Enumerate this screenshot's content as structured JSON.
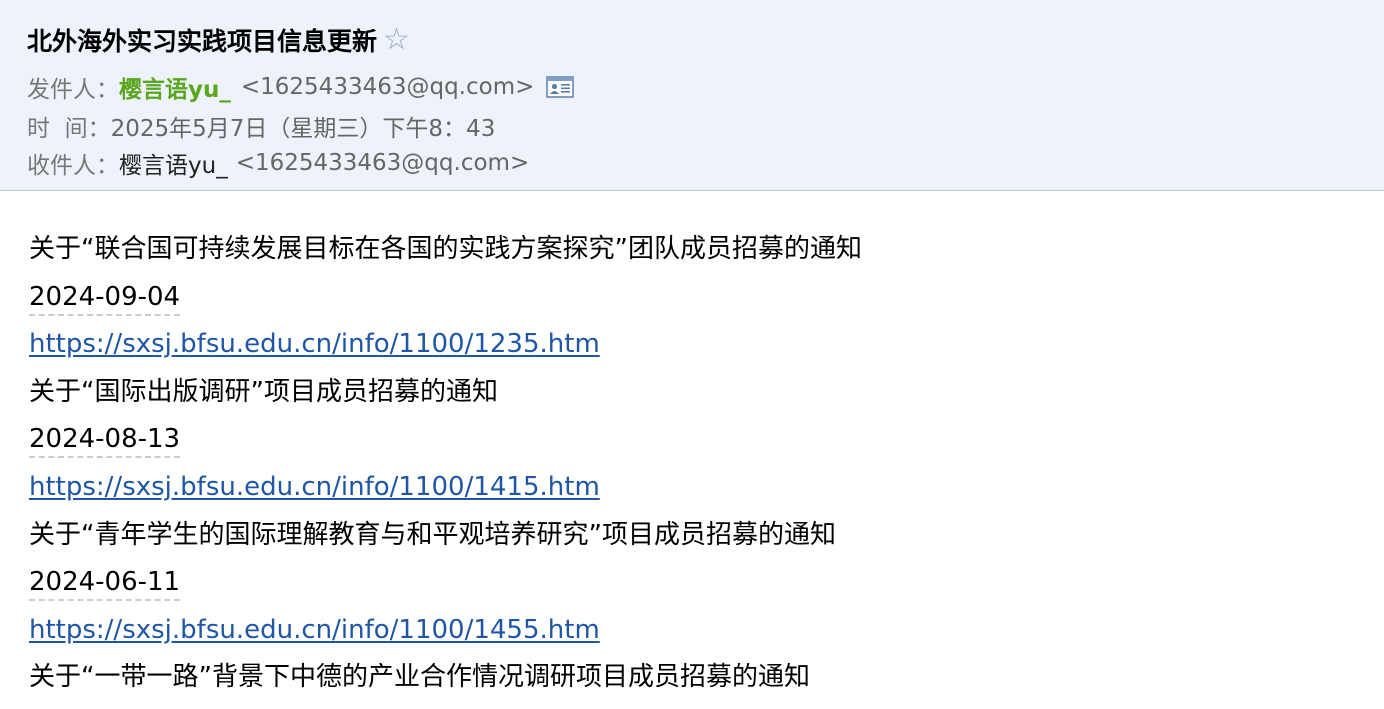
{
  "header": {
    "subject": "北外海外实习实践项目信息更新",
    "star_glyph": "☆",
    "from_label": "发件人：",
    "sender_name": "樱言语yu_",
    "sender_email": "<1625433463@qq.com>",
    "time_label": "时  间：",
    "time_value": "2025年5月7日（星期三）下午8：43",
    "to_label": "收件人：",
    "recipient_name": "樱言语yu_",
    "recipient_email": "<1625433463@qq.com>",
    "icons": {
      "star": "star-outline-icon",
      "contact_card": "contact-card-icon"
    },
    "colors": {
      "header_bg": "#eef3fb",
      "sender_name": "#5aa61f",
      "link": "#1f56a6"
    }
  },
  "body": {
    "notices": [
      {
        "title": "关于“联合国可持续发展目标在各国的实践方案探究”团队成员招募的通知",
        "date": "2024-09-04",
        "url": "https://sxsj.bfsu.edu.cn/info/1100/1235.htm"
      },
      {
        "title": "关于“国际出版调研”项目成员招募的通知",
        "date": "2024-08-13",
        "url": "https://sxsj.bfsu.edu.cn/info/1100/1415.htm"
      },
      {
        "title": "关于“青年学生的国际理解教育与和平观培养研究”项目成员招募的通知",
        "date": "2024-06-11",
        "url": "https://sxsj.bfsu.edu.cn/info/1100/1455.htm"
      },
      {
        "title": "关于“一带一路”背景下中德的产业合作情况调研项目成员招募的通知"
      }
    ]
  }
}
